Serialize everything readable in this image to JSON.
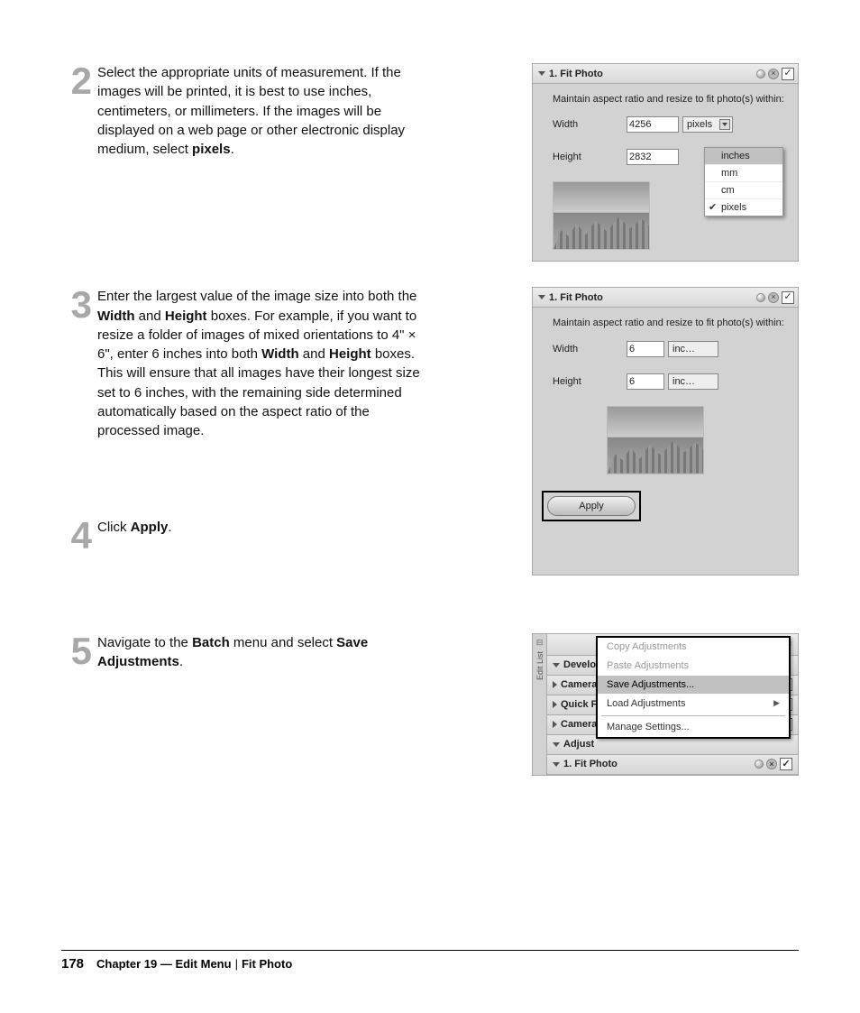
{
  "steps": {
    "s2": {
      "num": "2",
      "text_before": "Select the appropriate units of measurement. If the images will be printed, it is best to use inches, centimeters, or millimeters. If the images will be displayed on a web page or other electronic display medium, select ",
      "bold": "pixels",
      "text_after": "."
    },
    "s3": {
      "num": "3",
      "p1": "Enter the largest value of the image size into both the ",
      "b1": "Width",
      "p2": " and ",
      "b2": "Height",
      "p3": " boxes. For example, if you want to resize a folder of images of mixed orientations to 4\" × 6\", enter 6 inches into both ",
      "b3": "Width",
      "p4": " and ",
      "b4": "Height",
      "p5": " boxes. This will ensure that all images have their longest size set to 6 inches, with the remaining side determined automatically based on the aspect ratio of the processed image."
    },
    "s4": {
      "num": "4",
      "p1": "Click ",
      "b1": "Apply",
      "p2": "."
    },
    "s5": {
      "num": "5",
      "p1": "Navigate to the ",
      "b1": "Batch",
      "p2": " menu and select ",
      "b2": "Save Adjustments",
      "p3": "."
    }
  },
  "panel1": {
    "title": "1. Fit Photo",
    "desc": "Maintain aspect ratio and resize to fit photo(s) within:",
    "width_label": "Width",
    "height_label": "Height",
    "width_value": "4256",
    "height_value": "2832",
    "unit_selected": "pixels",
    "unit_menu": [
      "inches",
      "mm",
      "cm",
      "pixels"
    ],
    "unit_checked": "pixels"
  },
  "panel2": {
    "title": "1. Fit Photo",
    "desc": "Maintain aspect ratio and resize to fit photo(s) within:",
    "width_label": "Width",
    "height_label": "Height",
    "width_value": "6",
    "height_value": "6",
    "unit_label": "inc…",
    "apply_label": "Apply"
  },
  "batch": {
    "side_label": "Edit List",
    "rows": {
      "develop": "Develop",
      "camera_settings": "Camera S",
      "quick_fix": "Quick Fix",
      "camera_lens": "Camera & Lens Corrections",
      "adjust": "Adjust",
      "fit_photo": "1. Fit Photo"
    },
    "menu": {
      "copy": "Copy Adjustments",
      "paste": "Paste Adjustments",
      "save": "Save Adjustments...",
      "load": "Load Adjustments",
      "manage": "Manage Settings..."
    }
  },
  "footer": {
    "page": "178",
    "chapter": "Chapter 19 — Edit Menu",
    "section": "Fit Photo"
  }
}
